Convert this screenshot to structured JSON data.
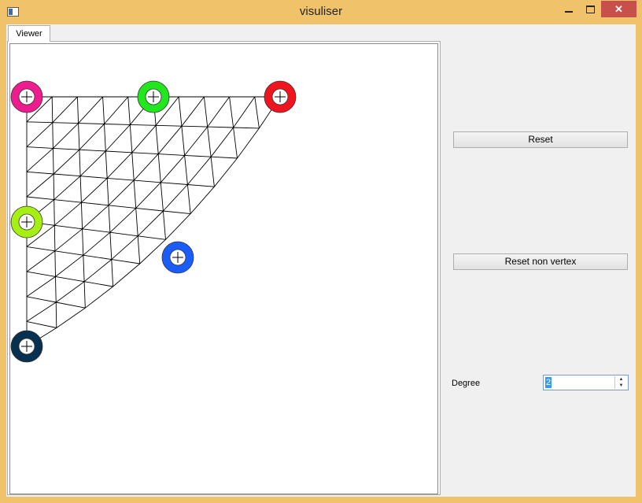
{
  "window": {
    "title": "visuliser",
    "close_glyph": "✕"
  },
  "tabs": [
    {
      "label": "Viewer"
    }
  ],
  "controls": {
    "reset_label": "Reset",
    "reset_non_vertex_label": "Reset non vertex",
    "degree_label": "Degree",
    "degree_value": "2",
    "spin_up_glyph": "▲",
    "spin_down_glyph": "▼"
  },
  "control_points": [
    {
      "name": "control-point-magenta",
      "color": "#ee1c8f"
    },
    {
      "name": "control-point-green",
      "color": "#22e61e"
    },
    {
      "name": "control-point-red",
      "color": "#f0141e"
    },
    {
      "name": "control-point-lime",
      "color": "#a6ef12"
    },
    {
      "name": "control-point-blue",
      "color": "#1a5dfa"
    },
    {
      "name": "control-point-navy",
      "color": "#083150"
    }
  ]
}
